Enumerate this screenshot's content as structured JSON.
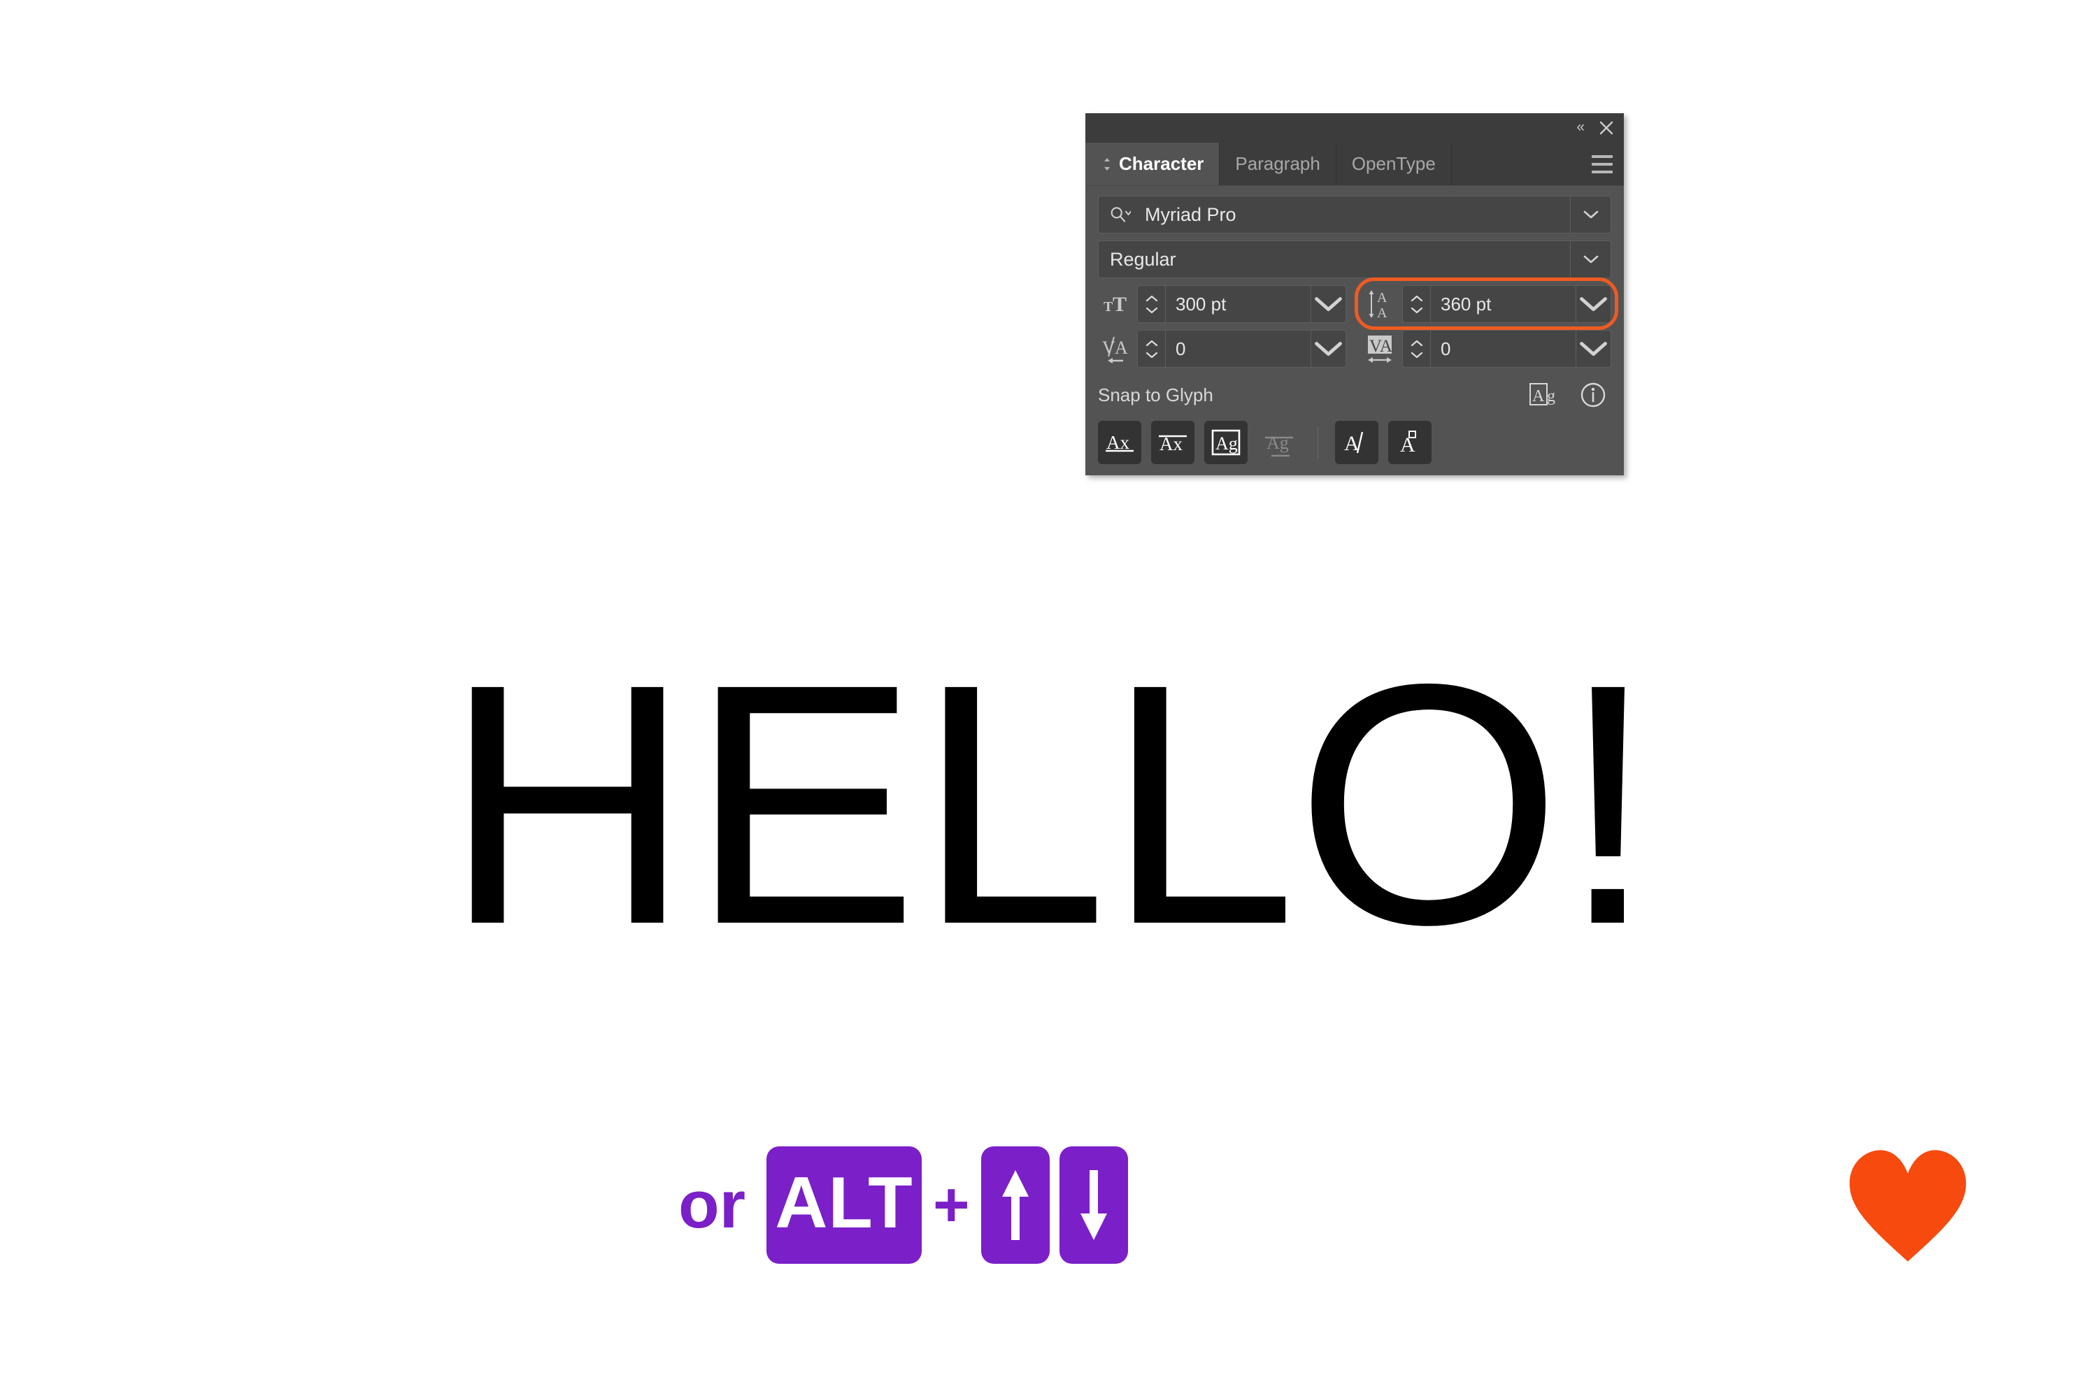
{
  "canvas": {
    "background": "#ffffff",
    "headline": "HELLO!",
    "headline_color": "#000000"
  },
  "panel": {
    "titlebar": {
      "collapse_label": "«",
      "close_icon": "close-icon"
    },
    "tabs": [
      {
        "label": "Character",
        "active": true
      },
      {
        "label": "Paragraph",
        "active": false
      },
      {
        "label": "OpenType",
        "active": false
      }
    ],
    "menu_icon": "hamburger-menu-icon",
    "font_family": {
      "value": "Myriad Pro",
      "search_icon": "search-icon",
      "dropdown_icon": "chevron-down-icon"
    },
    "font_style": {
      "value": "Regular",
      "dropdown_icon": "chevron-down-icon"
    },
    "font_size": {
      "icon": "font-size-icon",
      "value": "300 pt"
    },
    "leading": {
      "icon": "leading-icon",
      "value": "360 pt",
      "highlighted": true,
      "highlight_color": "#F05A22"
    },
    "kerning": {
      "icon": "kerning-icon",
      "value": "0"
    },
    "tracking": {
      "icon": "tracking-icon",
      "value": "0"
    },
    "snap_to_glyph": {
      "label": "Snap to Glyph",
      "preview_icon": "ag-preview-icon",
      "info_icon": "info-icon"
    },
    "glyph_buttons": [
      {
        "name": "align-baseline-ax",
        "label": "Ax",
        "state": "normal"
      },
      {
        "name": "align-cap-height-ax",
        "label": "Ax",
        "state": "normal"
      },
      {
        "name": "align-em-box-ag",
        "label": "Ag",
        "state": "selected"
      },
      {
        "name": "align-descender-ag",
        "label": "Ag",
        "state": "disabled"
      },
      {
        "name": "italic-angle-a",
        "label": "A",
        "state": "normal"
      },
      {
        "name": "accent-a",
        "label": "A",
        "state": "normal"
      }
    ],
    "colors": {
      "panel_bg": "#535353",
      "header_bg": "#3c3c3c",
      "field_bg": "#454545",
      "text": "#e8e8e8"
    }
  },
  "shortcut": {
    "or_label": "or",
    "alt_key": "ALT",
    "plus_label": "+",
    "arrow_up": "arrow-up-icon",
    "arrow_down": "arrow-down-icon",
    "key_color": "#7B1FC8"
  },
  "heart": {
    "name": "heart-icon",
    "color": "#F64A0F"
  }
}
